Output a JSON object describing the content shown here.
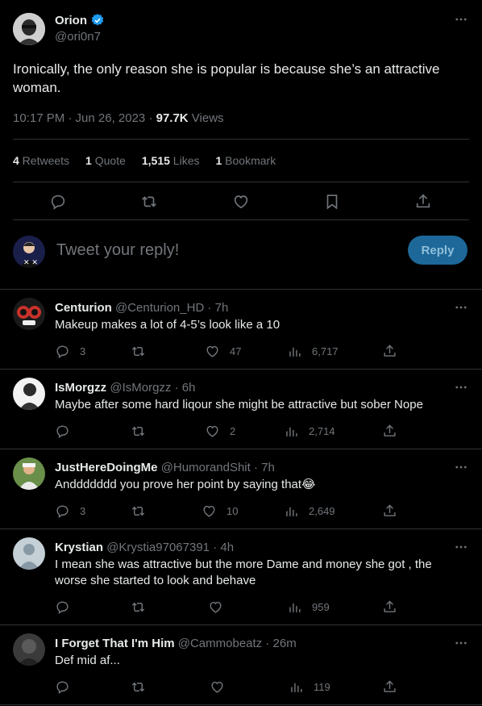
{
  "tweet": {
    "author_name": "Orion",
    "author_handle": "@ori0n7",
    "text": "Ironically, the only reason she is popular is because she’s an attractive woman.",
    "time": "10:17 PM · Jun 26, 2023 · ",
    "views_count": "97.7K",
    "views_label": " Views",
    "stats": {
      "retweets_count": "4",
      "retweets_label": " Retweets",
      "quotes_count": "1",
      "quotes_label": " Quote",
      "likes_count": "1,515",
      "likes_label": " Likes",
      "bookmarks_count": "1",
      "bookmarks_label": " Bookmark"
    }
  },
  "composer": {
    "placeholder": "Tweet your reply!",
    "reply_label": "Reply"
  },
  "replies": [
    {
      "name": "Centurion",
      "handle": "@Centurion_HD",
      "time": " · 7h",
      "text": "Makeup makes a lot of 4-5’s look like a 10",
      "replies": "3",
      "retweets": "",
      "likes": "47",
      "views": "6,717"
    },
    {
      "name": "IsMorgzz",
      "handle": "@IsMorgzz",
      "time": " · 6h",
      "text": "Maybe after some hard liqour she might be attractive but sober Nope",
      "replies": "",
      "retweets": "",
      "likes": "2",
      "views": "2,714"
    },
    {
      "name": "JustHereDoingMe",
      "handle": "@HumorandShit",
      "time": " · 7h",
      "text": "Anddddddd you prove her point by saying that😂",
      "replies": "3",
      "retweets": "",
      "likes": "10",
      "views": "2,649"
    },
    {
      "name": "Krystian",
      "handle": "@Krystia97067391",
      "time": " · 4h",
      "text": "I mean she was attractive but the more Dame and money she got , the worse she started to look and behave",
      "replies": "",
      "retweets": "",
      "likes": "",
      "views": "959"
    },
    {
      "name": "I Forget That I'm Him",
      "handle": "@Cammobeatz",
      "time": " · 26m",
      "text": "Def mid af...",
      "replies": "",
      "retweets": "",
      "likes": "",
      "views": "119"
    }
  ],
  "colors": {
    "background": "#000000",
    "text": "#e7e9ea",
    "muted": "#71767b",
    "verified": "#1d9bf0",
    "reply_button": "#1d6899",
    "divider": "#2f3336"
  },
  "icons": [
    "verified-badge-icon",
    "more-icon",
    "reply-icon",
    "retweet-icon",
    "like-icon",
    "bookmark-icon",
    "share-icon",
    "views-icon"
  ]
}
